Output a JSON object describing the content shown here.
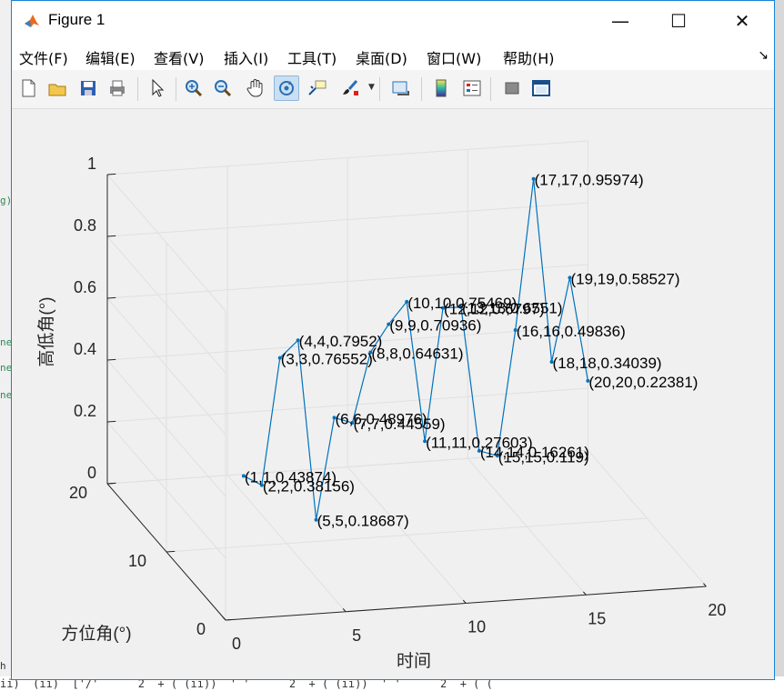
{
  "window": {
    "title": "Figure 1",
    "minimize_glyph": "—",
    "maximize_glyph": "☐",
    "close_glyph": "✕"
  },
  "menu": [
    {
      "label": "文件(F)"
    },
    {
      "label": "编辑(E)"
    },
    {
      "label": "查看(V)"
    },
    {
      "label": "插入(I)"
    },
    {
      "label": "工具(T)"
    },
    {
      "label": "桌面(D)"
    },
    {
      "label": "窗口(W)"
    },
    {
      "label": "帮助(H)"
    }
  ],
  "menu_overflow_glyph": "↘",
  "toolbar": [
    {
      "icon": "new-figure-icon"
    },
    {
      "icon": "open-file-icon"
    },
    {
      "icon": "save-icon"
    },
    {
      "icon": "print-icon"
    },
    {
      "icon": "pointer-icon"
    },
    {
      "icon": "zoom-in-icon"
    },
    {
      "icon": "zoom-out-icon"
    },
    {
      "icon": "pan-hand-icon"
    },
    {
      "icon": "rotate-3d-icon",
      "active": true
    },
    {
      "icon": "data-cursor-icon"
    },
    {
      "icon": "brush-icon"
    },
    {
      "icon": "link-plot-icon"
    },
    {
      "icon": "colorbar-icon"
    },
    {
      "icon": "legend-icon"
    },
    {
      "icon": "hide-plot-tools-icon"
    },
    {
      "icon": "show-plot-tools-icon"
    }
  ],
  "background": {
    "bottom_text": "ii)  (ii)  ['/'      2  + ( (ii))  ' '      2  + ( (ii))  ' '      2  + ( (",
    "left_fragments": [
      "g)",
      "ne",
      "ne",
      "ne",
      "h"
    ]
  },
  "colors": {
    "line": "#0072bd",
    "grid": "#e0e0e0",
    "axes": "#262626",
    "accent": "#1883d7"
  },
  "chart_data": {
    "type": "line",
    "dimension": "3d",
    "xlabel": "时间",
    "ylabel": "方位角(°)",
    "zlabel": "高低角(°)",
    "xlim": [
      0,
      20
    ],
    "ylim": [
      0,
      20
    ],
    "zlim": [
      0,
      1
    ],
    "xticks": [
      "0",
      "5",
      "10",
      "15",
      "20"
    ],
    "yticks": [
      "0",
      "10",
      "20"
    ],
    "zticks": [
      "0",
      "0.2",
      "0.4",
      "0.6",
      "0.8",
      "1"
    ],
    "grid": true,
    "points": [
      {
        "x": 1,
        "y": 1,
        "z": 0.43874,
        "label": "(1,1,0.43874)"
      },
      {
        "x": 2,
        "y": 2,
        "z": 0.38156,
        "label": "(2,2,0.38156)"
      },
      {
        "x": 3,
        "y": 3,
        "z": 0.76552,
        "label": "(3,3,0.76552)"
      },
      {
        "x": 4,
        "y": 4,
        "z": 0.7952,
        "label": "(4,4,0.7952)"
      },
      {
        "x": 5,
        "y": 5,
        "z": 0.18687,
        "label": "(5,5,0.18687)"
      },
      {
        "x": 6,
        "y": 6,
        "z": 0.48976,
        "label": "(6,6,0.48976)"
      },
      {
        "x": 7,
        "y": 7,
        "z": 0.44559,
        "label": "(7,7,0.44559)"
      },
      {
        "x": 8,
        "y": 8,
        "z": 0.64631,
        "label": "(8,8,0.64631)"
      },
      {
        "x": 9,
        "y": 9,
        "z": 0.70936,
        "label": "(9,9,0.70936)"
      },
      {
        "x": 10,
        "y": 10,
        "z": 0.75469,
        "label": "(10,10,0.75469)"
      },
      {
        "x": 11,
        "y": 11,
        "z": 0.27603,
        "label": "(11,11,0.27603)"
      },
      {
        "x": 12,
        "y": 12,
        "z": 0.6797,
        "label": "(12,12,0.6797)"
      },
      {
        "x": 13,
        "y": 13,
        "z": 0.6551,
        "label": "(13,13,0.6551)"
      },
      {
        "x": 14,
        "y": 14,
        "z": 0.16261,
        "label": "(14,14,0.16261)"
      },
      {
        "x": 15,
        "y": 15,
        "z": 0.119,
        "label": "(15,15,0.119)"
      },
      {
        "x": 16,
        "y": 16,
        "z": 0.49836,
        "label": "(16,16,0.49836)"
      },
      {
        "x": 17,
        "y": 17,
        "z": 0.95974,
        "label": "(17,17,0.95974)"
      },
      {
        "x": 18,
        "y": 18,
        "z": 0.34039,
        "label": "(18,18,0.34039)"
      },
      {
        "x": 19,
        "y": 19,
        "z": 0.58527,
        "label": "(19,19,0.58527)"
      },
      {
        "x": 20,
        "y": 20,
        "z": 0.22381,
        "label": "(20,20,0.22381)"
      }
    ]
  }
}
